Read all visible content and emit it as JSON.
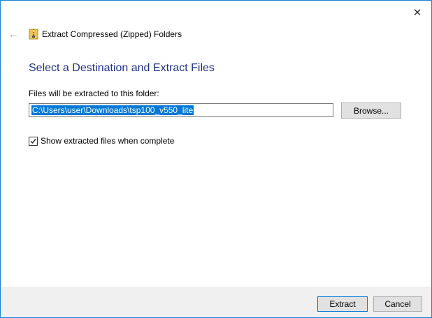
{
  "window": {
    "title": "Extract Compressed (Zipped) Folders",
    "close_glyph": "✕",
    "back_glyph": "←"
  },
  "main": {
    "heading": "Select a Destination and Extract Files",
    "destination_label": "Files will be extracted to this folder:",
    "destination_value": "C:\\Users\\user\\Downloads\\tsp100_v550_lite",
    "browse_label": "Browse...",
    "show_files_label": "Show extracted files when complete",
    "show_files_checked": true
  },
  "footer": {
    "extract_label": "Extract",
    "cancel_label": "Cancel"
  },
  "colors": {
    "heading": "#1e3287",
    "selection": "#0078d7",
    "border": "#1883d7"
  }
}
